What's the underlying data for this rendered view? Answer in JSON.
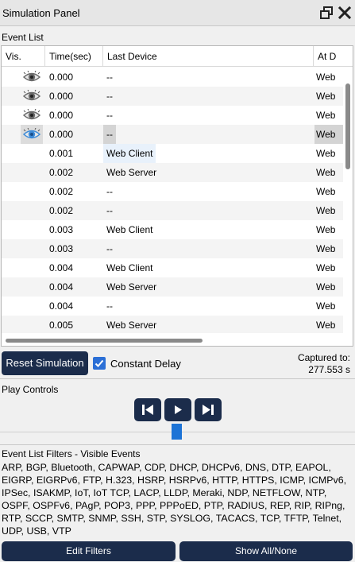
{
  "panel": {
    "title": "Simulation Panel"
  },
  "icons": {
    "restore": "restore-window-icon",
    "close": "close-icon",
    "visible": "eye-icon"
  },
  "colors": {
    "dark_button": "#1b2c4b",
    "accent_blue": "#1d73d6",
    "checkbox": "#2b6fd6"
  },
  "event_list": {
    "label": "Event List",
    "columns": [
      "Vis.",
      "Time(sec)",
      "Last Device",
      "At D"
    ],
    "rows": [
      {
        "eye": true,
        "eye_highlight": false,
        "time": "0.000",
        "last": "--",
        "at": "Web",
        "hl": ""
      },
      {
        "eye": true,
        "eye_highlight": false,
        "time": "0.000",
        "last": "--",
        "at": "Web",
        "hl": ""
      },
      {
        "eye": true,
        "eye_highlight": false,
        "time": "0.000",
        "last": "--",
        "at": "Web",
        "hl": ""
      },
      {
        "eye": true,
        "eye_highlight": true,
        "time": "0.000",
        "last": "--",
        "at": "Web",
        "hl": "dark"
      },
      {
        "eye": false,
        "eye_highlight": false,
        "time": "0.001",
        "last": "Web Client",
        "at": "Web",
        "hl": "light"
      },
      {
        "eye": false,
        "eye_highlight": false,
        "time": "0.002",
        "last": "Web Server",
        "at": "Web",
        "hl": ""
      },
      {
        "eye": false,
        "eye_highlight": false,
        "time": "0.002",
        "last": "--",
        "at": "Web",
        "hl": ""
      },
      {
        "eye": false,
        "eye_highlight": false,
        "time": "0.002",
        "last": "--",
        "at": "Web",
        "hl": ""
      },
      {
        "eye": false,
        "eye_highlight": false,
        "time": "0.003",
        "last": "Web Client",
        "at": "Web",
        "hl": ""
      },
      {
        "eye": false,
        "eye_highlight": false,
        "time": "0.003",
        "last": "--",
        "at": "Web",
        "hl": ""
      },
      {
        "eye": false,
        "eye_highlight": false,
        "time": "0.004",
        "last": "Web Client",
        "at": "Web",
        "hl": ""
      },
      {
        "eye": false,
        "eye_highlight": false,
        "time": "0.004",
        "last": "Web Server",
        "at": "Web",
        "hl": ""
      },
      {
        "eye": false,
        "eye_highlight": false,
        "time": "0.004",
        "last": "--",
        "at": "Web",
        "hl": ""
      },
      {
        "eye": false,
        "eye_highlight": false,
        "time": "0.005",
        "last": "Web Server",
        "at": "Web",
        "hl": ""
      }
    ]
  },
  "controls": {
    "reset_label": "Reset Simulation",
    "constant_delay_label": "Constant Delay",
    "constant_delay_checked": true,
    "captured_label": "Captured to:",
    "captured_value": "277.553 s"
  },
  "play_controls": {
    "label": "Play Controls",
    "buttons": [
      "skip-to-start-icon",
      "play-icon",
      "skip-to-end-icon"
    ]
  },
  "filters": {
    "label": "Event List Filters - Visible Events",
    "text": "ARP, BGP, Bluetooth, CAPWAP, CDP, DHCP, DHCPv6, DNS, DTP, EAPOL, EIGRP, EIGRPv6, FTP, H.323, HSRP, HSRPv6, HTTP, HTTPS, ICMP, ICMPv6, IPSec, ISAKMP, IoT, IoT TCP, LACP, LLDP, Meraki, NDP, NETFLOW, NTP, OSPF, OSPFv6, PAgP, POP3, PPP, PPPoED, PTP, RADIUS, REP, RIP, RIPng, RTP, SCCP, SMTP, SNMP, SSH, STP, SYSLOG, TACACS, TCP, TFTP, Telnet, UDP, USB, VTP",
    "edit_label": "Edit Filters",
    "show_all_label": "Show All/None"
  }
}
